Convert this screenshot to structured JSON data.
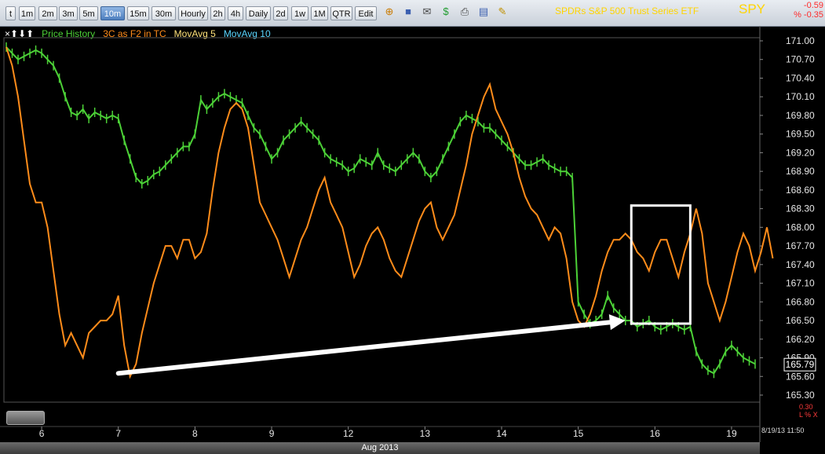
{
  "toolbar": {
    "intervals": [
      {
        "label": "t",
        "x": 7,
        "w": 13,
        "active": false
      },
      {
        "label": "1m",
        "x": 24,
        "w": 21,
        "active": false
      },
      {
        "label": "2m",
        "x": 49,
        "w": 24,
        "active": false
      },
      {
        "label": "3m",
        "x": 75,
        "w": 24,
        "active": false
      },
      {
        "label": "5m",
        "x": 101,
        "w": 24,
        "active": false
      },
      {
        "label": "10m",
        "x": 128,
        "w": 31,
        "active": true
      },
      {
        "label": "15m",
        "x": 162,
        "w": 28,
        "active": false
      },
      {
        "label": "30m",
        "x": 193,
        "w": 31,
        "active": false
      },
      {
        "label": "Hourly",
        "x": 227,
        "w": 38,
        "active": false
      },
      {
        "label": "2h",
        "x": 268,
        "w": 19,
        "active": false
      },
      {
        "label": "4h",
        "x": 290,
        "w": 20,
        "active": false
      },
      {
        "label": "Daily",
        "x": 313,
        "w": 32,
        "active": false
      },
      {
        "label": "2d",
        "x": 348,
        "w": 19,
        "active": false
      },
      {
        "label": "1w",
        "x": 371,
        "w": 22,
        "active": false
      },
      {
        "label": "1M",
        "x": 396,
        "w": 22,
        "active": false
      },
      {
        "label": "QTR",
        "x": 421,
        "w": 28,
        "active": false
      },
      {
        "label": "Edit",
        "x": 452,
        "w": 28,
        "active": false
      }
    ],
    "icons": [
      {
        "name": "bookmark-add-icon",
        "glyph": "⊕",
        "x": 487,
        "color": "#c97a00"
      },
      {
        "name": "save-icon",
        "glyph": "■",
        "x": 511,
        "color": "#3b5fb0"
      },
      {
        "name": "mail-icon",
        "glyph": "✉",
        "x": 535,
        "color": "#444"
      },
      {
        "name": "dollar-icon",
        "glyph": "$",
        "x": 559,
        "color": "#1f9b2e"
      },
      {
        "name": "print-icon",
        "glyph": "⎙",
        "x": 583,
        "color": "#444"
      },
      {
        "name": "ticket-icon",
        "glyph": "▤",
        "x": 607,
        "color": "#3b5fb0"
      },
      {
        "name": "pencil-icon",
        "glyph": "✎",
        "x": 631,
        "color": "#c09000"
      }
    ],
    "title": "SPDRs S&P 500 Trust Series ETF",
    "symbol": "SPY",
    "change": "-0.59",
    "pct_change": "% -0.35"
  },
  "legend": {
    "arrows": "×⬆⬇⬆",
    "items": [
      {
        "label": "Price History",
        "color": "#4cd137"
      },
      {
        "label": "3C as F2 in TC",
        "color": "#ff8c1a"
      },
      {
        "label": "MovAvg 5",
        "color": "#ffe27a"
      },
      {
        "label": "MovAvg 10",
        "color": "#5ad6ff"
      }
    ]
  },
  "chart_data": {
    "type": "line",
    "ylim": [
      165.3,
      171.0
    ],
    "y_ticks": [
      "171.00",
      "170.70",
      "170.40",
      "170.10",
      "169.80",
      "169.50",
      "169.20",
      "168.90",
      "168.60",
      "168.30",
      "168.00",
      "167.70",
      "167.40",
      "167.10",
      "166.80",
      "166.50",
      "166.20",
      "165.90",
      "165.60",
      "165.30"
    ],
    "x_ticks": [
      {
        "label": "6",
        "i": 6
      },
      {
        "label": "7",
        "i": 19
      },
      {
        "label": "8",
        "i": 32
      },
      {
        "label": "9",
        "i": 45
      },
      {
        "label": "12",
        "i": 58
      },
      {
        "label": "13",
        "i": 71
      },
      {
        "label": "14",
        "i": 84
      },
      {
        "label": "15",
        "i": 97
      },
      {
        "label": "16",
        "i": 110
      },
      {
        "label": "19",
        "i": 123
      }
    ],
    "x_label": "Aug 2013",
    "last_price": "165.79",
    "price_color": "#4cd137",
    "indicator_color": "#ff8c1a",
    "series": [
      {
        "name": "Price History",
        "values": [
          170.9,
          170.8,
          170.7,
          170.75,
          170.8,
          170.85,
          170.8,
          170.7,
          170.6,
          170.4,
          170.1,
          169.85,
          169.8,
          169.9,
          169.75,
          169.85,
          169.8,
          169.75,
          169.8,
          169.75,
          169.4,
          169.1,
          168.8,
          168.7,
          168.75,
          168.85,
          168.9,
          169.0,
          169.1,
          169.2,
          169.3,
          169.3,
          169.5,
          170.05,
          169.9,
          170.0,
          170.1,
          170.15,
          170.1,
          170.05,
          170.0,
          169.8,
          169.6,
          169.5,
          169.3,
          169.1,
          169.2,
          169.4,
          169.5,
          169.6,
          169.7,
          169.6,
          169.5,
          169.4,
          169.2,
          169.1,
          169.05,
          169.0,
          168.9,
          168.95,
          169.1,
          169.05,
          169.0,
          169.2,
          169.0,
          168.95,
          168.9,
          169.0,
          169.1,
          169.2,
          169.1,
          168.9,
          168.8,
          168.9,
          169.1,
          169.3,
          169.5,
          169.7,
          169.8,
          169.75,
          169.7,
          169.6,
          169.6,
          169.5,
          169.4,
          169.3,
          169.2,
          169.1,
          169.0,
          169.0,
          169.05,
          169.1,
          169.0,
          168.95,
          168.9,
          168.9,
          168.8,
          166.8,
          166.6,
          166.45,
          166.5,
          166.6,
          166.9,
          166.7,
          166.6,
          166.5,
          166.5,
          166.4,
          166.45,
          166.5,
          166.4,
          166.35,
          166.4,
          166.45,
          166.4,
          166.35,
          166.4,
          166.0,
          165.8,
          165.7,
          165.65,
          165.8,
          166.0,
          166.1,
          166.0,
          165.9,
          165.85,
          165.8
        ]
      },
      {
        "name": "3C as F2 in TC",
        "values": [
          170.9,
          170.6,
          170.1,
          169.4,
          168.7,
          168.4,
          168.4,
          168.0,
          167.3,
          166.6,
          166.1,
          166.3,
          166.1,
          165.9,
          166.3,
          166.4,
          166.5,
          166.5,
          166.6,
          166.9,
          166.1,
          165.6,
          165.8,
          166.3,
          166.7,
          167.1,
          167.4,
          167.7,
          167.7,
          167.5,
          167.8,
          167.8,
          167.5,
          167.6,
          167.9,
          168.6,
          169.2,
          169.6,
          169.9,
          170.0,
          169.9,
          169.6,
          169.0,
          168.4,
          168.2,
          168.0,
          167.8,
          167.5,
          167.2,
          167.5,
          167.8,
          168.0,
          168.3,
          168.6,
          168.8,
          168.4,
          168.2,
          168.0,
          167.6,
          167.2,
          167.4,
          167.7,
          167.9,
          168.0,
          167.8,
          167.5,
          167.3,
          167.2,
          167.5,
          167.8,
          168.1,
          168.3,
          168.4,
          168.0,
          167.8,
          168.0,
          168.2,
          168.6,
          169.0,
          169.5,
          169.8,
          170.1,
          170.3,
          169.9,
          169.7,
          169.5,
          169.2,
          168.8,
          168.5,
          168.3,
          168.2,
          168.0,
          167.8,
          168.0,
          167.9,
          167.5,
          166.8,
          166.5,
          166.4,
          166.6,
          166.9,
          167.3,
          167.6,
          167.8,
          167.8,
          167.9,
          167.8,
          167.6,
          167.5,
          167.3,
          167.6,
          167.8,
          167.8,
          167.5,
          167.2,
          167.6,
          167.9,
          168.3,
          167.9,
          167.1,
          166.8,
          166.5,
          166.8,
          167.2,
          167.6,
          167.9,
          167.7,
          167.3,
          167.6,
          168.0,
          167.5
        ]
      }
    ],
    "annotations": [
      {
        "type": "arrow",
        "color": "#ffffff",
        "from": {
          "i": 19,
          "y": 165.65
        },
        "to": {
          "i": 105,
          "y": 166.5
        }
      },
      {
        "type": "box",
        "color": "#ffffff",
        "from": {
          "i": 106,
          "y": 166.45
        },
        "to": {
          "i": 116,
          "y": 168.35
        }
      }
    ],
    "indicator_pane_label": "0.30",
    "indicator_pane_sub": "L % X",
    "timestamp": "8/19/13 11:50"
  }
}
